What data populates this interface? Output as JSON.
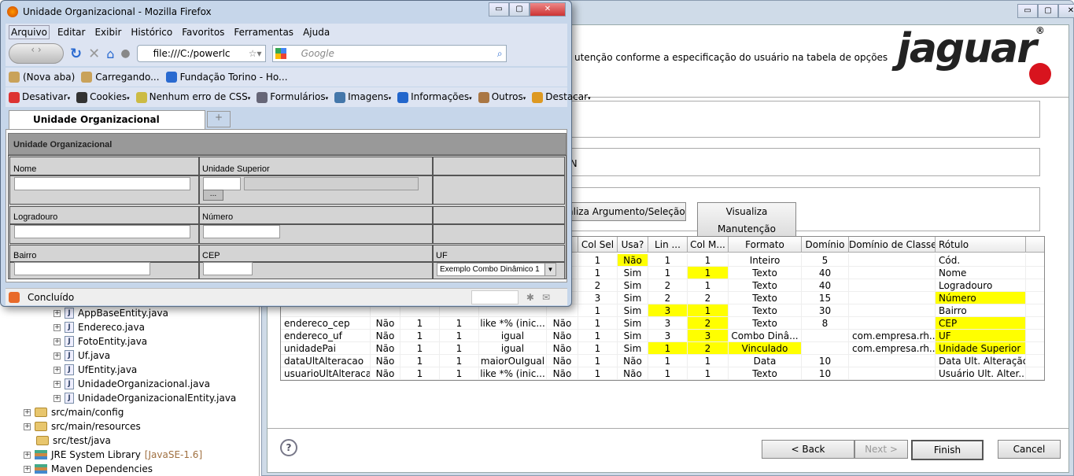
{
  "tree": {
    "items": [
      {
        "label": "AppBaseEntity.java",
        "type": "java"
      },
      {
        "label": "Endereco.java",
        "type": "java-warn"
      },
      {
        "label": "FotoEntity.java",
        "type": "java-warn"
      },
      {
        "label": "Uf.java",
        "type": "java-warn"
      },
      {
        "label": "UfEntity.java",
        "type": "java-warn"
      },
      {
        "label": "UnidadeOrganizacional.java",
        "type": "java-warn"
      },
      {
        "label": "UnidadeOrganizacionalEntity.java",
        "type": "java"
      },
      {
        "label": "src/main/config",
        "type": "folder"
      },
      {
        "label": "src/main/resources",
        "type": "folder"
      },
      {
        "label": "src/test/java",
        "type": "folder"
      },
      {
        "label": "JRE System Library",
        "suffix": "[JavaSE-1.6]",
        "type": "library"
      },
      {
        "label": "Maven Dependencies",
        "type": "library"
      }
    ]
  },
  "wizard": {
    "description": "utenção conforme a especificação do usuário na tabela de opções",
    "logo": "jaguar",
    "group2_text": "3N",
    "btn_arg": "aliza Argumento/Seleção",
    "btn_man": "Visualiza Manutenção",
    "columns": [
      "",
      "",
      "",
      "",
      "",
      "",
      "Col Sel",
      "Usa?",
      "Lin ...",
      "Col M...",
      "Formato",
      "Domínio",
      "Domínio de Classe",
      "Rótulo",
      ""
    ],
    "rows": [
      {
        "cells": [
          "",
          "",
          "",
          "",
          "",
          "",
          "1",
          "Não",
          "1",
          "1",
          "Inteiro",
          "5",
          "",
          "Cód.",
          ""
        ],
        "hl": [
          7
        ]
      },
      {
        "cells": [
          "",
          "",
          "",
          "",
          "",
          "",
          "1",
          "Sim",
          "1",
          "1",
          "Texto",
          "40",
          "",
          "Nome",
          ""
        ],
        "hl": [
          9
        ]
      },
      {
        "cells": [
          "",
          "",
          "",
          "",
          "",
          "",
          "2",
          "Sim",
          "2",
          "1",
          "Texto",
          "40",
          "",
          "Logradouro",
          ""
        ],
        "hl": []
      },
      {
        "cells": [
          "",
          "",
          "",
          "",
          "",
          "",
          "3",
          "Sim",
          "2",
          "2",
          "Texto",
          "15",
          "",
          "Número",
          ""
        ],
        "hl": [
          13
        ]
      },
      {
        "cells": [
          "",
          "",
          "",
          "",
          "",
          "",
          "1",
          "Sim",
          "3",
          "1",
          "Texto",
          "30",
          "",
          "Bairro",
          ""
        ],
        "hl": [
          8,
          9
        ]
      },
      {
        "cells": [
          "endereco_cep",
          "Não",
          "1",
          "1",
          "like *% (inic...",
          "Não",
          "1",
          "Sim",
          "3",
          "2",
          "Texto",
          "8",
          "",
          "CEP",
          ""
        ],
        "hl": [
          9,
          13
        ]
      },
      {
        "cells": [
          "endereco_uf",
          "Não",
          "1",
          "1",
          "igual",
          "Não",
          "1",
          "Sim",
          "3",
          "3",
          "Combo Dinâ...",
          "",
          "com.empresa.rh...",
          "UF",
          ""
        ],
        "hl": [
          9,
          13
        ]
      },
      {
        "cells": [
          "unidadePai",
          "Não",
          "1",
          "1",
          "igual",
          "Não",
          "1",
          "Sim",
          "1",
          "2",
          "Vinculado",
          "",
          "com.empresa.rh...",
          "Unidade Superior",
          ""
        ],
        "hl": [
          8,
          9,
          10,
          13
        ]
      },
      {
        "cells": [
          "dataUltAlteracao",
          "Não",
          "1",
          "1",
          "maiorOuIgual",
          "Não",
          "1",
          "Não",
          "1",
          "1",
          "Data",
          "10",
          "",
          "Data Ult. Alteração",
          ""
        ],
        "hl": []
      },
      {
        "cells": [
          "usuarioUltAlteracao",
          "Não",
          "1",
          "1",
          "like *% (inic...",
          "Não",
          "1",
          "Não",
          "1",
          "1",
          "Texto",
          "10",
          "",
          "Usuário Ult. Alter...",
          ""
        ],
        "hl": []
      }
    ],
    "highlight_color": "#ffff00",
    "back": "< Back",
    "next": "Next >",
    "finish": "Finish",
    "cancel": "Cancel"
  },
  "firefox": {
    "title": "Unidade Organizacional - Mozilla Firefox",
    "menu": [
      "Arquivo",
      "Editar",
      "Exibir",
      "Histórico",
      "Favoritos",
      "Ferramentas",
      "Ajuda"
    ],
    "url": "file:///C:/powerlc",
    "search_placeholder": "Google",
    "bookmarks": [
      "(Nova aba)",
      "Carregando...",
      "Fundação Torino - Ho..."
    ],
    "devtools": [
      "Desativar",
      "Cookies",
      "Nenhum erro de CSS",
      "Formulários",
      "Imagens",
      "Informações",
      "Outros",
      "Destacar"
    ],
    "tab": "Unidade Organizacional",
    "form": {
      "header": "Unidade Organizacional",
      "nome": "Nome",
      "unidade_superior": "Unidade Superior",
      "lookup": "...",
      "logradouro": "Logradouro",
      "numero": "Número",
      "bairro": "Bairro",
      "cep": "CEP",
      "uf": "UF",
      "uf_value": "Exemplo Combo Dinâmico 1"
    },
    "status": "Concluído"
  }
}
